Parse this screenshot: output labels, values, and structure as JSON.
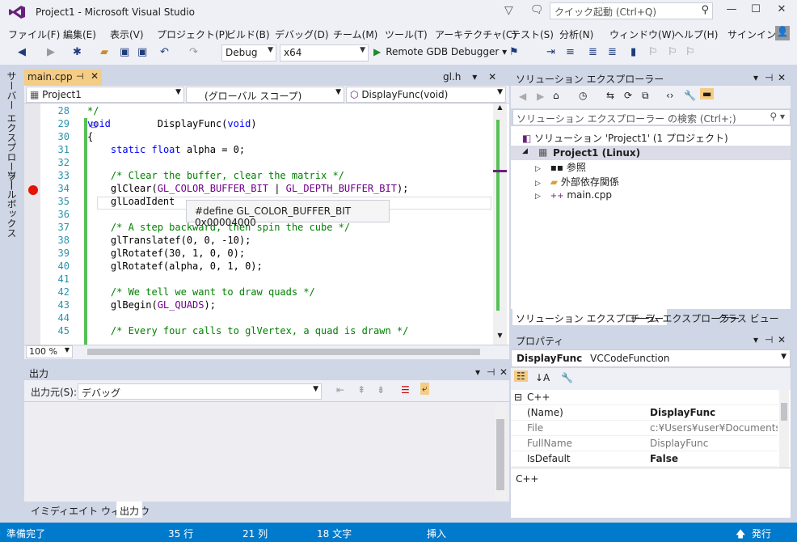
{
  "window": {
    "title": "Project1 - Microsoft Visual Studio",
    "quick_launch_placeholder": "クイック起動 (Ctrl+Q)",
    "buttons": [
      "—",
      "☐",
      "✕"
    ]
  },
  "menu": [
    "ファイル(F)",
    "編集(E)",
    "表示(V)",
    "プロジェクト(P)",
    "ビルド(B)",
    "デバッグ(D)",
    "チーム(M)",
    "ツール(T)",
    "アーキテクチャ(C)",
    "テスト(S)",
    "分析(N)",
    "ウィンドウ(W)",
    "ヘルプ(H)",
    "サインイン"
  ],
  "toolbar": {
    "configuration": "Debug",
    "platform": "x64",
    "debugger": "Remote GDB Debugger"
  },
  "left_tabs": [
    "サーバー エクスプローラー",
    "ツールボックス"
  ],
  "editor": {
    "tab": "main.cpp",
    "right_tab": "gl.h",
    "nav_project": "Project1",
    "nav_scope": "(グローバル スコープ)",
    "nav_function": "DisplayFunc(void)",
    "zoom": "100 %",
    "tooltip": "#define GL_COLOR_BUFFER_BIT 0x00004000",
    "line_numbers": [
      "28",
      "29",
      "30",
      "31",
      "32",
      "33",
      "34",
      "35",
      "36",
      "37",
      "38",
      "39",
      "40",
      "41",
      "42",
      "43",
      "44",
      "45"
    ],
    "lines": [
      {
        "seg": [
          {
            "t": "*/",
            "c": "cm"
          }
        ]
      },
      {
        "seg": [
          {
            "t": "void",
            "c": "kw"
          },
          {
            "t": "        DisplayFunc("
          },
          {
            "t": "void",
            "c": "kw"
          },
          {
            "t": ")"
          }
        ]
      },
      {
        "seg": [
          {
            "t": "{"
          }
        ]
      },
      {
        "seg": [
          {
            "t": "    "
          },
          {
            "t": "static",
            "c": "kw"
          },
          {
            "t": " "
          },
          {
            "t": "float",
            "c": "kw"
          },
          {
            "t": " alpha = 0;"
          }
        ]
      },
      {
        "seg": [
          {
            "t": ""
          }
        ]
      },
      {
        "seg": [
          {
            "t": "    "
          },
          {
            "t": "/* Clear the buffer, clear the matrix */",
            "c": "cm"
          }
        ]
      },
      {
        "seg": [
          {
            "t": "    glClear("
          },
          {
            "t": "GL_COLOR_BUFFER_BIT",
            "c": "mc"
          },
          {
            "t": " | "
          },
          {
            "t": "GL_DEPTH_BUFFER_BIT",
            "c": "mc"
          },
          {
            "t": ");"
          }
        ]
      },
      {
        "seg": [
          {
            "t": "    glLoadIdent"
          }
        ]
      },
      {
        "seg": [
          {
            "t": ""
          }
        ]
      },
      {
        "seg": [
          {
            "t": "    "
          },
          {
            "t": "/* A step backward, then spin the cube */",
            "c": "cm"
          }
        ]
      },
      {
        "seg": [
          {
            "t": "    glTranslatef(0, 0, -10);"
          }
        ]
      },
      {
        "seg": [
          {
            "t": "    glRotatef(30, 1, 0, 0);"
          }
        ]
      },
      {
        "seg": [
          {
            "t": "    glRotatef(alpha, 0, 1, 0);"
          }
        ]
      },
      {
        "seg": [
          {
            "t": ""
          }
        ]
      },
      {
        "seg": [
          {
            "t": "    "
          },
          {
            "t": "/* We tell we want to draw quads */",
            "c": "cm"
          }
        ]
      },
      {
        "seg": [
          {
            "t": "    glBegin("
          },
          {
            "t": "GL_QUADS",
            "c": "mc"
          },
          {
            "t": ");"
          }
        ]
      },
      {
        "seg": [
          {
            "t": ""
          }
        ]
      },
      {
        "seg": [
          {
            "t": "    "
          },
          {
            "t": "/* Every four calls to glVertex, a quad is drawn */",
            "c": "cm"
          }
        ]
      }
    ]
  },
  "output": {
    "title": "出力",
    "source_label": "出力元(S):",
    "source_value": "デバッグ",
    "tabs": [
      "イミディエイト ウィンドウ",
      "出力"
    ]
  },
  "solution_explorer": {
    "title": "ソリューション エクスプローラー",
    "search_placeholder": "ソリューション エクスプローラー の検索 (Ctrl+;)",
    "tree": [
      {
        "label": "ソリューション 'Project1' (1 プロジェクト)",
        "indent": 0,
        "icon": "solution-icon"
      },
      {
        "label": "Project1 (Linux)",
        "indent": 1,
        "icon": "project-icon",
        "bold": true,
        "selected": true
      },
      {
        "label": "参照",
        "indent": 2,
        "icon": "references-icon"
      },
      {
        "label": "外部依存関係",
        "indent": 2,
        "icon": "folder-icon"
      },
      {
        "label": "main.cpp",
        "indent": 2,
        "icon": "cpp-file-icon"
      }
    ],
    "tabs": [
      "ソリューション エクスプローラー",
      "チーム エクスプローラー",
      "クラス ビュー"
    ]
  },
  "properties": {
    "title": "プロパティ",
    "object_name": "DisplayFunc",
    "object_type": "VCCodeFunction",
    "category": "C++",
    "rows": [
      {
        "name": "(Name)",
        "value": "DisplayFunc",
        "bold": true
      },
      {
        "name": "File",
        "value": "c:¥Users¥user¥Documents¥V",
        "bold": false
      },
      {
        "name": "FullName",
        "value": "DisplayFunc",
        "bold": false
      },
      {
        "name": "IsDefault",
        "value": "False",
        "bold": true
      }
    ],
    "description": "C++"
  },
  "status": {
    "state": "準備完了",
    "line": "35 行",
    "col": "21 列",
    "char": "18 文字",
    "mode": "挿入",
    "publish": "発行"
  },
  "colors": {
    "accent": "#007acc",
    "breakpoint": "#e51400",
    "doc_tab": "#f5cc84"
  }
}
